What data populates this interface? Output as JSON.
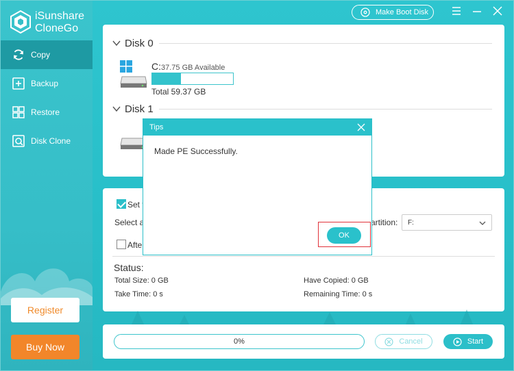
{
  "app": {
    "name_line1": "iSunshare",
    "name_line2": "CloneGo"
  },
  "sidebar": {
    "items": [
      {
        "label": "Copy",
        "icon": "refresh-icon",
        "active": true
      },
      {
        "label": "Backup",
        "icon": "backup-icon",
        "active": false
      },
      {
        "label": "Restore",
        "icon": "restore-icon",
        "active": false
      },
      {
        "label": "Disk Clone",
        "icon": "disk-clone-icon",
        "active": false
      }
    ],
    "register_label": "Register",
    "buy_label": "Buy Now"
  },
  "topbar": {
    "make_boot_label": "Make Boot Disk"
  },
  "disks": [
    {
      "name": "Disk 0",
      "partition": {
        "letter": "C:",
        "available": "37.75 GB Available",
        "total": "Total 59.37 GB",
        "used_fraction": 0.36
      }
    },
    {
      "name": "Disk 1"
    }
  ],
  "options": {
    "set_target_label": "Set t",
    "select_label": "Select a",
    "partition_label": "artition:",
    "partition_value": "F:",
    "after_label": "After"
  },
  "status": {
    "title": "Status:",
    "total_size": "Total Size: 0 GB",
    "have_copied": "Have Copied: 0 GB",
    "take_time": "Take Time: 0 s",
    "remaining_time": "Remaining Time: 0 s"
  },
  "bottom": {
    "progress_text": "0%",
    "cancel_label": "Cancel",
    "start_label": "Start"
  },
  "dialog": {
    "title": "Tips",
    "message": "Made PE Successfully.",
    "ok_label": "OK"
  },
  "colors": {
    "accent": "#2ac1cb",
    "sidebar_active": "#1e9aa3",
    "buy": "#f2862a",
    "highlight": "#e0323a"
  }
}
